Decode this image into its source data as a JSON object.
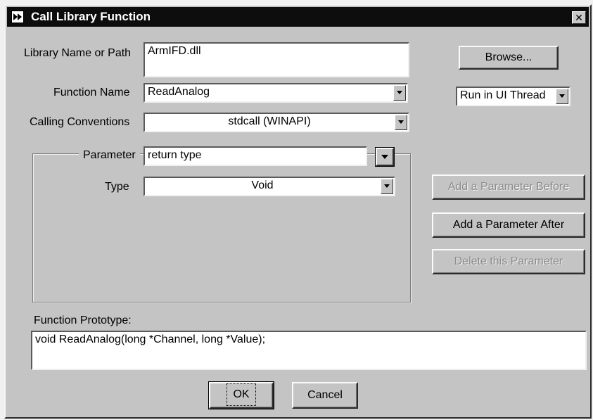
{
  "window": {
    "title": "Call Library Function",
    "close_glyph": "✕"
  },
  "library": {
    "label": "Library Name or Path",
    "value": "ArmIFD.dll",
    "browse_button": "Browse..."
  },
  "function": {
    "label": "Function Name",
    "value": "ReadAnalog",
    "thread_value": "Run in UI Thread"
  },
  "calling": {
    "label": "Calling Conventions",
    "value": "stdcall (WINAPI)"
  },
  "parameter": {
    "label": "Parameter",
    "value": "return type",
    "type_label": "Type",
    "type_value": "Void"
  },
  "side_buttons": {
    "add_before": "Add a Parameter Before",
    "add_after": "Add a Parameter After",
    "delete": "Delete this Parameter"
  },
  "prototype": {
    "label": "Function Prototype:",
    "value": "void ReadAnalog(long *Channel, long *Value);"
  },
  "footer": {
    "ok": "OK",
    "cancel": "Cancel"
  },
  "icons": {
    "title": "run-arrow-icon",
    "dropdown": "dropdown-arrow-icon"
  }
}
